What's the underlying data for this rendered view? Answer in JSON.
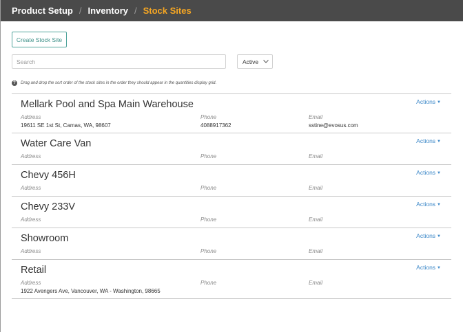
{
  "breadcrumb": {
    "items": [
      "Product Setup",
      "Inventory",
      "Stock Sites"
    ],
    "separator": "/"
  },
  "toolbar": {
    "create_label": "Create Stock Site",
    "search_placeholder": "Search",
    "status_value": "Active"
  },
  "hint_text": "Drag and drop the sort order of the stock sites in the order they should appear in the quantities display grid.",
  "labels": {
    "address": "Address",
    "phone": "Phone",
    "email": "Email",
    "actions": "Actions"
  },
  "sites": [
    {
      "name": "Mellark Pool and Spa Main Warehouse",
      "address": "19611 SE 1st St, Camas, WA, 98607",
      "phone": "4088917362",
      "email": "sstine@evosus.com"
    },
    {
      "name": "Water Care Van",
      "address": "",
      "phone": "",
      "email": ""
    },
    {
      "name": "Chevy 456H",
      "address": "",
      "phone": "",
      "email": ""
    },
    {
      "name": "Chevy 233V",
      "address": "",
      "phone": "",
      "email": ""
    },
    {
      "name": "Showroom",
      "address": "",
      "phone": "",
      "email": ""
    },
    {
      "name": "Retail",
      "address": "1922 Avengers Ave, Vancouver, WA - Washington, 98665",
      "phone": "",
      "email": ""
    }
  ],
  "colors": {
    "topbar": "#4a4a4a",
    "active_crumb": "#f5a623",
    "teal_button": "#3b8f87",
    "link_blue": "#3a87c8"
  }
}
